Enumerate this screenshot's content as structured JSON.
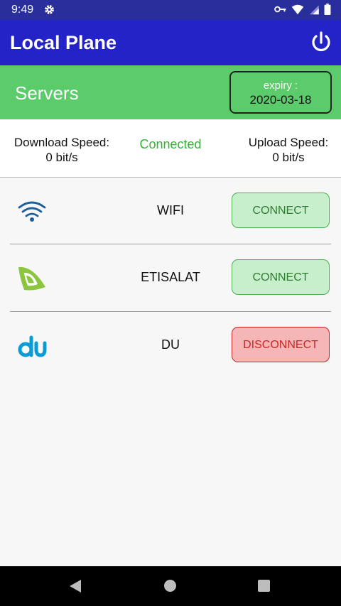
{
  "status_bar": {
    "time": "9:49"
  },
  "app_bar": {
    "title": "Local Plane"
  },
  "servers_bar": {
    "title": "Servers",
    "expiry_label": "expiry :",
    "expiry_date": "2020-03-18"
  },
  "speed": {
    "download_label": "Download Speed:",
    "download_value": "0 bit/s",
    "status": "Connected",
    "upload_label": "Upload Speed:",
    "upload_value": "0 bit/s"
  },
  "servers": [
    {
      "name": "WIFI",
      "action": "CONNECT",
      "icon": "wifi-icon"
    },
    {
      "name": "ETISALAT",
      "action": "CONNECT",
      "icon": "etisalat-logo"
    },
    {
      "name": "DU",
      "action": "DISCONNECT",
      "icon": "du-logo"
    }
  ],
  "colors": {
    "app_bar": "#2323c8",
    "servers_bar": "#5ccb6b",
    "connected_text": "#2db62d",
    "connect_button": "#c8efcb",
    "disconnect_button": "#f4b6b6"
  }
}
